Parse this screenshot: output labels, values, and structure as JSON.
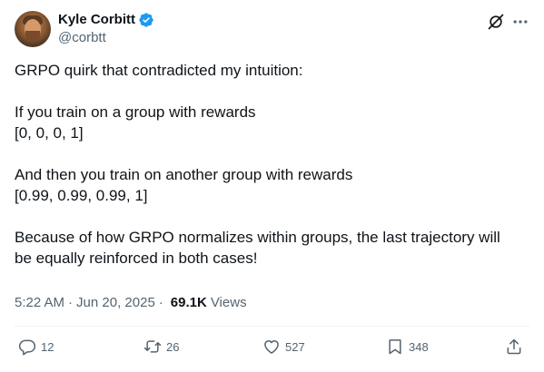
{
  "author": {
    "name": "Kyle Corbitt",
    "handle": "@corbtt"
  },
  "icons": {
    "verified": "verified-badge-icon",
    "grok": "grok-icon",
    "more": "more-icon",
    "reply": "reply-icon",
    "retweet": "retweet-icon",
    "like": "heart-icon",
    "bookmark": "bookmark-icon",
    "share": "share-icon"
  },
  "colors": {
    "verified": "#1d9bf0",
    "text": "#0f1419",
    "secondary": "#536471"
  },
  "tweet": {
    "lines": [
      "GRPO quirk that contradicted my intuition:",
      "If you train on a group with rewards",
      "[0, 0, 0, 1]",
      "And then you train on another group with rewards",
      "[0.99, 0.99, 0.99, 1]",
      "Because of how GRPO normalizes within groups, the last trajectory will",
      "be equally reinforced in both cases!"
    ]
  },
  "meta": {
    "time": "5:22 AM",
    "separator": "·",
    "date": "Jun 20, 2025",
    "views_count": "69.1K",
    "views_label": "Views"
  },
  "actions": {
    "replies": "12",
    "retweets": "26",
    "likes": "527",
    "bookmarks": "348"
  }
}
